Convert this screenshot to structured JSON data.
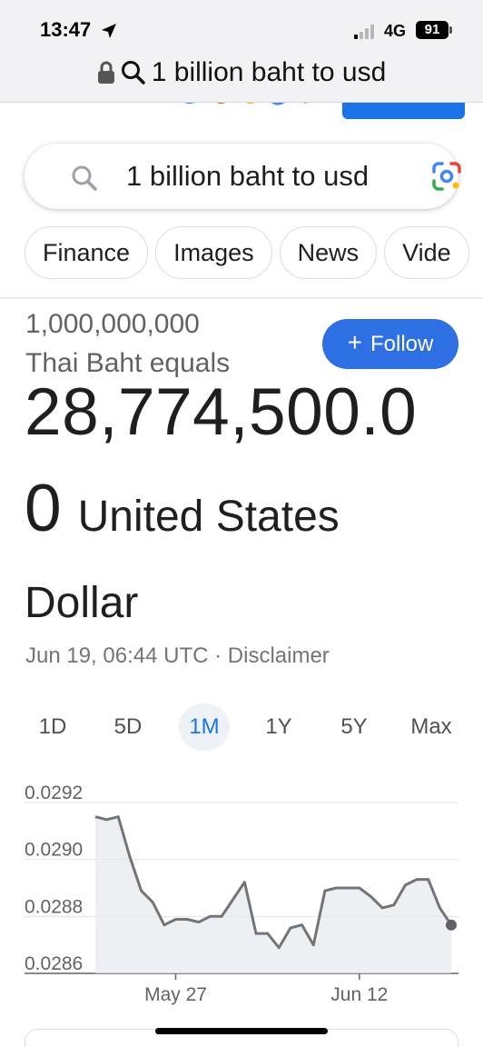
{
  "status_bar": {
    "time": "13:47",
    "network": "4G",
    "battery": "91"
  },
  "address_bar": {
    "url_text": "1 billion baht to usd"
  },
  "search": {
    "query": "1 billion baht to usd"
  },
  "chips": [
    "Finance",
    "Images",
    "News",
    "Vide"
  ],
  "converter": {
    "from_amount": "1,000,000,000",
    "from_currency_text": "Thai Baht equals",
    "result_line1": "28,774,500.0",
    "result_line2_number": "0",
    "result_line2_unit": "United States",
    "result_line3": "Dollar",
    "timestamp": "Jun 19, 06:44 UTC · Disclaimer",
    "follow_label": "Follow"
  },
  "ranges": [
    "1D",
    "5D",
    "1M",
    "1Y",
    "5Y",
    "Max"
  ],
  "active_range": "1M",
  "colors": {
    "accent": "#1a73e8",
    "follow_bg": "#2f6fe4",
    "line": "#70757a",
    "area": "#e8eaed"
  },
  "chart_data": {
    "type": "area",
    "x": [
      "May 20",
      "May 21",
      "May 22",
      "May 23",
      "May 24",
      "May 25",
      "May 26",
      "May 27",
      "May 28",
      "May 29",
      "May 30",
      "May 31",
      "Jun 1",
      "Jun 2",
      "Jun 3",
      "Jun 4",
      "Jun 5",
      "Jun 6",
      "Jun 7",
      "Jun 8",
      "Jun 9",
      "Jun 10",
      "Jun 11",
      "Jun 12",
      "Jun 13",
      "Jun 14",
      "Jun 15",
      "Jun 16",
      "Jun 17",
      "Jun 18",
      "Jun 19"
    ],
    "series": [
      {
        "values": [
          0.02915,
          0.02914,
          0.02915,
          0.02901,
          0.02889,
          0.02885,
          0.02877,
          0.02879,
          0.02879,
          0.02878,
          0.0288,
          0.0288,
          0.02886,
          0.02892,
          0.02874,
          0.02874,
          0.02869,
          0.02876,
          0.02877,
          0.0287,
          0.02889,
          0.0289,
          0.0289,
          0.0289,
          0.02887,
          0.02883,
          0.02884,
          0.02891,
          0.02893,
          0.02893,
          0.02883,
          0.02877
        ]
      }
    ],
    "y_ticks": [
      "0.0292",
      "0.0290",
      "0.0288",
      "0.0286"
    ],
    "x_ticks": [
      "May 27",
      "Jun 12"
    ],
    "ylim": [
      0.0286,
      0.0292
    ],
    "grid": true
  }
}
